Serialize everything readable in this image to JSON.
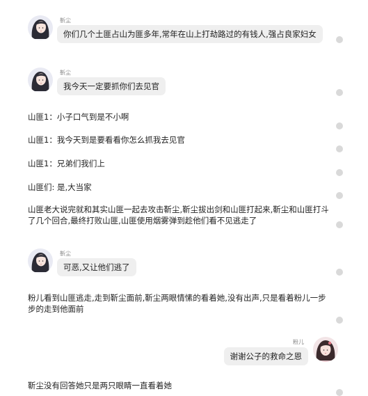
{
  "colors": {
    "bubble": "#efefef",
    "name": "#8a8a8a",
    "text": "#222222",
    "dot": "#d9d9d9"
  },
  "chat": {
    "msg1": {
      "speaker": "靳尘",
      "text": "你们几个土匪占山为匪多年,常年在山上打劫路过的有钱人,强占良家妇女"
    },
    "msg2": {
      "speaker": "靳尘",
      "text": "我今天一定要抓你们去见官"
    },
    "line1": "山匪1：小子口气到是不小啊",
    "line2": "山匪1：我今天到是要看看你怎么抓我去见官",
    "line3": "山匪1：兄弟们我们上",
    "line4": "山匪们: 是,大当家",
    "para1": "山匪老大说完就和其实山匪一起去攻击靳尘,靳尘拔出剑和山匪打起来,靳尘和山匪打斗了几个回合,最终打败山匪,山匪使用烟雾弹到趁他们看不见逃走了",
    "msg3": {
      "speaker": "靳尘",
      "text": "可恶,又让他们逃了"
    },
    "para2": "粉儿看到山匪逃走,走到靳尘面前,靳尘两眼情愫的看着她,没有出声,只是看着粉儿一步步的走到他面前",
    "msg4": {
      "speaker": "粉儿",
      "text": "谢谢公子的救命之恩"
    },
    "line5": "靳尘没有回答她只是两只眼睛一直看着她"
  }
}
